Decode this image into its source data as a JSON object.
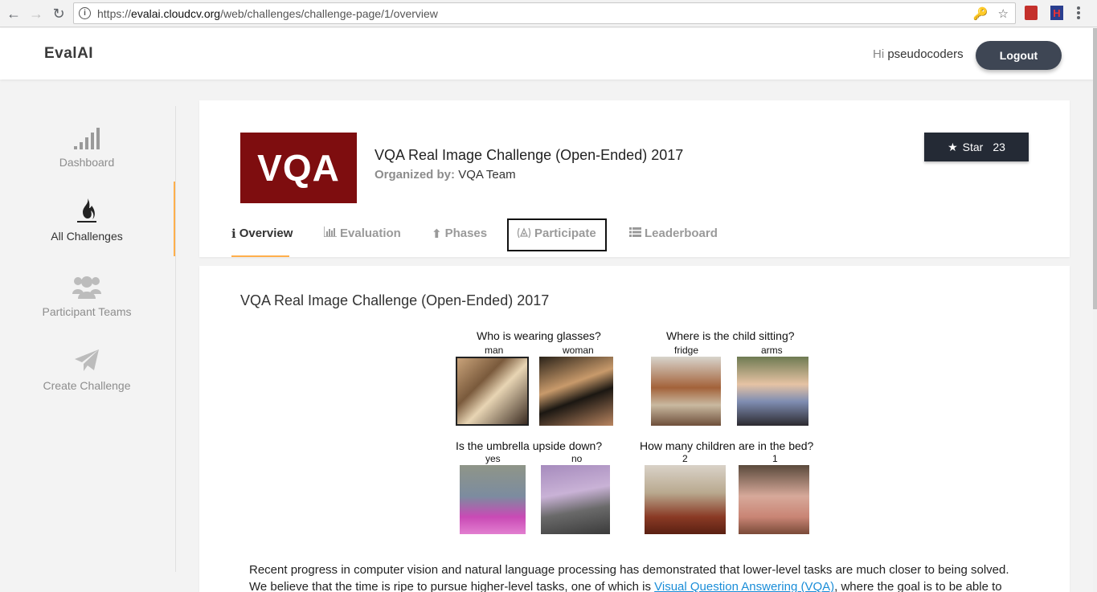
{
  "browser": {
    "url_scheme": "https://",
    "url_host": "evalai.cloudcv.org",
    "url_path": "/web/challenges/challenge-page/1/overview"
  },
  "header": {
    "logo": "EvalAI",
    "greeting_prefix": "Hi",
    "username": "pseudocoders",
    "logout_label": "Logout"
  },
  "sidebar": {
    "items": [
      {
        "label": "Dashboard",
        "icon": "signal-bars-icon"
      },
      {
        "label": "All Challenges",
        "icon": "flame-icon"
      },
      {
        "label": "Participant Teams",
        "icon": "users-icon"
      },
      {
        "label": "Create Challenge",
        "icon": "paper-plane-icon"
      }
    ],
    "active_color": "#ffaf4b"
  },
  "challenge": {
    "logo_text": "VQA",
    "title": "VQA Real Image Challenge (Open-Ended) 2017",
    "organizer_label": "Organized by:",
    "organizer": "VQA Team",
    "star_label": "Star",
    "star_count": "23",
    "tabs": [
      {
        "label": "Overview",
        "icon": "info-icon"
      },
      {
        "label": "Evaluation",
        "icon": "bar-chart-icon"
      },
      {
        "label": "Phases",
        "icon": "upload-arrow-icon"
      },
      {
        "label": "Participate",
        "icon": "participate-icon"
      },
      {
        "label": "Leaderboard",
        "icon": "list-icon"
      }
    ]
  },
  "overview": {
    "title": "VQA Real Image Challenge (Open-Ended) 2017",
    "figure": {
      "q1": "Who is wearing glasses?",
      "q1_a1": "man",
      "q1_a2": "woman",
      "q2": "Where is the child sitting?",
      "q2_a1": "fridge",
      "q2_a2": "arms",
      "q3": "Is the umbrella upside down?",
      "q3_a1": "yes",
      "q3_a2": "no",
      "q4": "How many children are in the bed?",
      "q4_a1": "2",
      "q4_a2": "1"
    },
    "para_line1": "Recent progress in computer vision and natural language processing has demonstrated that lower-level tasks are much closer to being solved.",
    "para_line2_a": "We believe that the time is ripe to pursue higher-level tasks, one of which is ",
    "para_link": "Visual Question Answering (VQA)",
    "para_line2_b": ", where the goal is to be able to"
  }
}
